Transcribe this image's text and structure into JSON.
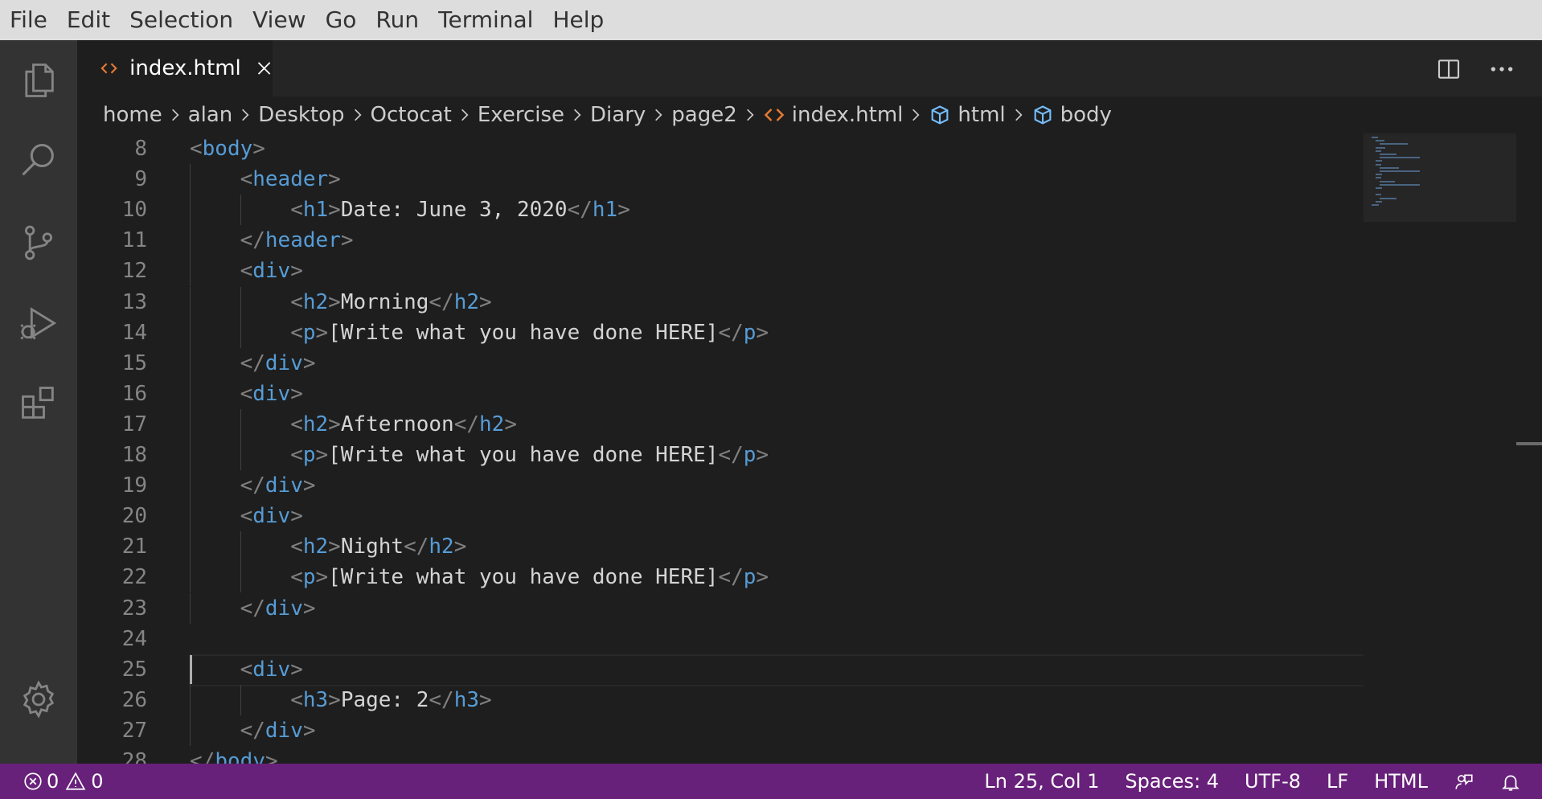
{
  "menu": [
    "File",
    "Edit",
    "Selection",
    "View",
    "Go",
    "Run",
    "Terminal",
    "Help"
  ],
  "tab": {
    "label": "index.html"
  },
  "breadcrumb": [
    "home",
    "alan",
    "Desktop",
    "Octocat",
    "Exercise",
    "Diary",
    "page2",
    "index.html",
    "html",
    "body"
  ],
  "code_lines": [
    {
      "num": "8",
      "indent": 0,
      "tokens": [
        [
          "b",
          "<"
        ],
        [
          "t",
          "body"
        ],
        [
          "b",
          ">"
        ]
      ]
    },
    {
      "num": "9",
      "indent": 1,
      "tokens": [
        [
          "b",
          "<"
        ],
        [
          "t",
          "header"
        ],
        [
          "b",
          ">"
        ]
      ]
    },
    {
      "num": "10",
      "indent": 2,
      "tokens": [
        [
          "b",
          "<"
        ],
        [
          "t",
          "h1"
        ],
        [
          "b",
          ">"
        ],
        [
          "x",
          "Date: June 3, 2020"
        ],
        [
          "b",
          "</"
        ],
        [
          "t",
          "h1"
        ],
        [
          "b",
          ">"
        ]
      ]
    },
    {
      "num": "11",
      "indent": 1,
      "tokens": [
        [
          "b",
          "</"
        ],
        [
          "t",
          "header"
        ],
        [
          "b",
          ">"
        ]
      ]
    },
    {
      "num": "12",
      "indent": 1,
      "tokens": [
        [
          "b",
          "<"
        ],
        [
          "t",
          "div"
        ],
        [
          "b",
          ">"
        ]
      ]
    },
    {
      "num": "13",
      "indent": 2,
      "tokens": [
        [
          "b",
          "<"
        ],
        [
          "t",
          "h2"
        ],
        [
          "b",
          ">"
        ],
        [
          "x",
          "Morning"
        ],
        [
          "b",
          "</"
        ],
        [
          "t",
          "h2"
        ],
        [
          "b",
          ">"
        ]
      ]
    },
    {
      "num": "14",
      "indent": 2,
      "tokens": [
        [
          "b",
          "<"
        ],
        [
          "t",
          "p"
        ],
        [
          "b",
          ">"
        ],
        [
          "x",
          "[Write what you have done HERE]"
        ],
        [
          "b",
          "</"
        ],
        [
          "t",
          "p"
        ],
        [
          "b",
          ">"
        ]
      ]
    },
    {
      "num": "15",
      "indent": 1,
      "tokens": [
        [
          "b",
          "</"
        ],
        [
          "t",
          "div"
        ],
        [
          "b",
          ">"
        ]
      ]
    },
    {
      "num": "16",
      "indent": 1,
      "tokens": [
        [
          "b",
          "<"
        ],
        [
          "t",
          "div"
        ],
        [
          "b",
          ">"
        ]
      ]
    },
    {
      "num": "17",
      "indent": 2,
      "tokens": [
        [
          "b",
          "<"
        ],
        [
          "t",
          "h2"
        ],
        [
          "b",
          ">"
        ],
        [
          "x",
          "Afternoon"
        ],
        [
          "b",
          "</"
        ],
        [
          "t",
          "h2"
        ],
        [
          "b",
          ">"
        ]
      ]
    },
    {
      "num": "18",
      "indent": 2,
      "tokens": [
        [
          "b",
          "<"
        ],
        [
          "t",
          "p"
        ],
        [
          "b",
          ">"
        ],
        [
          "x",
          "[Write what you have done HERE]"
        ],
        [
          "b",
          "</"
        ],
        [
          "t",
          "p"
        ],
        [
          "b",
          ">"
        ]
      ]
    },
    {
      "num": "19",
      "indent": 1,
      "tokens": [
        [
          "b",
          "</"
        ],
        [
          "t",
          "div"
        ],
        [
          "b",
          ">"
        ]
      ]
    },
    {
      "num": "20",
      "indent": 1,
      "tokens": [
        [
          "b",
          "<"
        ],
        [
          "t",
          "div"
        ],
        [
          "b",
          ">"
        ]
      ]
    },
    {
      "num": "21",
      "indent": 2,
      "tokens": [
        [
          "b",
          "<"
        ],
        [
          "t",
          "h2"
        ],
        [
          "b",
          ">"
        ],
        [
          "x",
          "Night"
        ],
        [
          "b",
          "</"
        ],
        [
          "t",
          "h2"
        ],
        [
          "b",
          ">"
        ]
      ]
    },
    {
      "num": "22",
      "indent": 2,
      "tokens": [
        [
          "b",
          "<"
        ],
        [
          "t",
          "p"
        ],
        [
          "b",
          ">"
        ],
        [
          "x",
          "[Write what you have done HERE]"
        ],
        [
          "b",
          "</"
        ],
        [
          "t",
          "p"
        ],
        [
          "b",
          ">"
        ]
      ]
    },
    {
      "num": "23",
      "indent": 1,
      "tokens": [
        [
          "b",
          "</"
        ],
        [
          "t",
          "div"
        ],
        [
          "b",
          ">"
        ]
      ]
    },
    {
      "num": "24",
      "indent": 0,
      "tokens": []
    },
    {
      "num": "25",
      "indent": 1,
      "tokens": [
        [
          "b",
          "<"
        ],
        [
          "t",
          "div"
        ],
        [
          "b",
          ">"
        ]
      ]
    },
    {
      "num": "26",
      "indent": 2,
      "tokens": [
        [
          "b",
          "<"
        ],
        [
          "t",
          "h3"
        ],
        [
          "b",
          ">"
        ],
        [
          "x",
          "Page: 2"
        ],
        [
          "b",
          "</"
        ],
        [
          "t",
          "h3"
        ],
        [
          "b",
          ">"
        ]
      ]
    },
    {
      "num": "27",
      "indent": 1,
      "tokens": [
        [
          "b",
          "</"
        ],
        [
          "t",
          "div"
        ],
        [
          "b",
          ">"
        ]
      ]
    },
    {
      "num": "28",
      "indent": 0,
      "tokens": [
        [
          "b",
          "</"
        ],
        [
          "t",
          "body"
        ],
        [
          "b",
          ">"
        ]
      ]
    }
  ],
  "current_line": "25",
  "status": {
    "errors": "0",
    "warnings": "0",
    "position": "Ln 25, Col 1",
    "spaces": "Spaces: 4",
    "encoding": "UTF-8",
    "eol": "LF",
    "language": "HTML"
  },
  "colors": {
    "status_bar": "#68217a",
    "tag": "#569cd6",
    "bracket": "#808080",
    "text": "#d4d4d4",
    "html_file_icon": "#e37933",
    "symbol_icon": "#75beff"
  },
  "icons": {
    "activity": [
      "explorer-icon",
      "search-icon",
      "source-control-icon",
      "run-debug-icon",
      "extensions-icon",
      "gear-icon"
    ],
    "tab_file": "html-file-icon",
    "tab_close": "close-icon",
    "breadcrumb_separator": "chevron-right-icon",
    "breadcrumb_symbol": "symbol-field-icon",
    "editor_actions": [
      "split-editor-icon",
      "more-actions-icon"
    ],
    "status": [
      "error-icon",
      "warning-icon",
      "feedback-icon",
      "bell-icon"
    ]
  }
}
